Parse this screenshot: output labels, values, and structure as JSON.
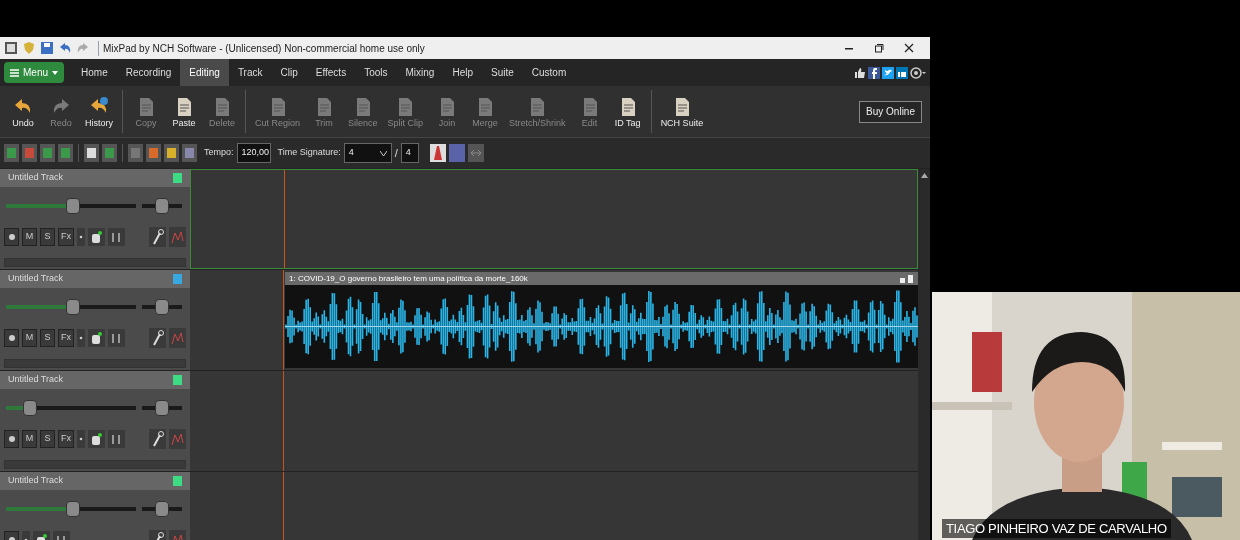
{
  "window": {
    "title": "MixPad by NCH Software - (Unlicensed) Non-commercial home use only"
  },
  "menu_button": {
    "label": "Menu"
  },
  "tabs": [
    {
      "label": "Home",
      "selected": false
    },
    {
      "label": "Recording",
      "selected": false
    },
    {
      "label": "Editing",
      "selected": true
    },
    {
      "label": "Track",
      "selected": false
    },
    {
      "label": "Clip",
      "selected": false
    },
    {
      "label": "Effects",
      "selected": false
    },
    {
      "label": "Tools",
      "selected": false
    },
    {
      "label": "Mixing",
      "selected": false
    },
    {
      "label": "Help",
      "selected": false
    },
    {
      "label": "Suite",
      "selected": false
    },
    {
      "label": "Custom",
      "selected": false
    }
  ],
  "toolbar_groups": [
    [
      {
        "label": "Undo",
        "disabled": false
      },
      {
        "label": "Redo",
        "disabled": true
      },
      {
        "label": "History",
        "disabled": false
      }
    ],
    [
      {
        "label": "Copy",
        "disabled": true
      },
      {
        "label": "Paste",
        "disabled": false
      },
      {
        "label": "Delete",
        "disabled": true
      }
    ],
    [
      {
        "label": "Cut Region",
        "disabled": true
      },
      {
        "label": "Trim",
        "disabled": true
      },
      {
        "label": "Silence",
        "disabled": true
      },
      {
        "label": "Split Clip",
        "disabled": true
      },
      {
        "label": "Join",
        "disabled": true
      },
      {
        "label": "Merge",
        "disabled": true
      },
      {
        "label": "Stretch/Shrink",
        "disabled": true
      },
      {
        "label": "Edit",
        "disabled": true
      },
      {
        "label": "ID Tag",
        "disabled": false
      }
    ],
    [
      {
        "label": "NCH Suite",
        "disabled": false
      }
    ]
  ],
  "buy_button": {
    "label": "Buy Online"
  },
  "tempo": {
    "label": "Tempo:",
    "value": "120,00"
  },
  "time_signature": {
    "label": "Time Signature:",
    "numerator": "4",
    "separator": "/",
    "denominator": "4"
  },
  "tracks": [
    {
      "name": "Untitled Track",
      "color": "#3ddc84",
      "selected": true,
      "volume": {
        "level": 0.52
      },
      "pan": {
        "level": 0.5
      },
      "buttons": [
        "M",
        "S",
        "Fx"
      ]
    },
    {
      "name": "Untitled Track",
      "color": "#3aa8e0",
      "selected": false,
      "volume": {
        "level": 0.52
      },
      "pan": {
        "level": 0.5
      },
      "buttons": [
        "M",
        "S",
        "Fx"
      ],
      "clip": {
        "title": "1: COVID-19_O governo brasileiro tem uma política da morte_160k"
      }
    },
    {
      "name": "Untitled Track",
      "color": "#3ddc84",
      "selected": false,
      "volume": {
        "level": 0.15
      },
      "pan": {
        "level": 0.5
      },
      "buttons": [
        "M",
        "S",
        "Fx"
      ]
    },
    {
      "name": "Untitled Track",
      "color": "#3ddc84",
      "selected": false,
      "volume": {
        "level": 0.52
      },
      "pan": {
        "level": 0.5
      }
    }
  ],
  "webcam": {
    "caption": "TIAGO PINHEIRO VAZ DE CARVALHO"
  }
}
